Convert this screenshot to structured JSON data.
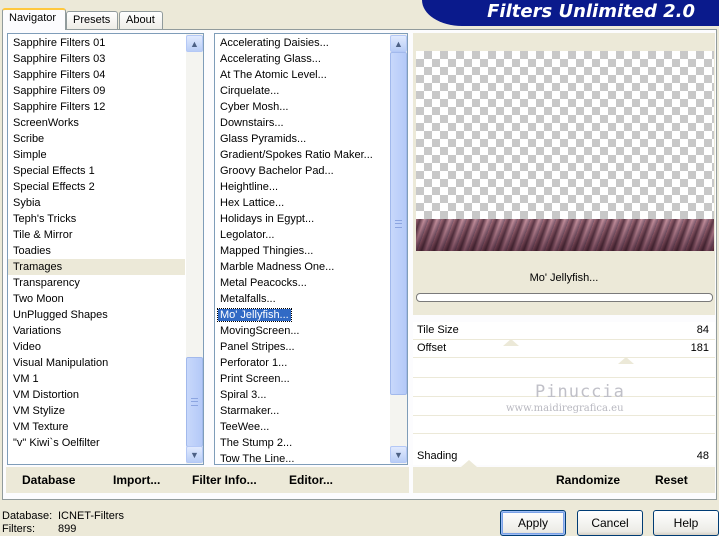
{
  "tabs": [
    "Navigator",
    "Presets",
    "About"
  ],
  "banner_title": "Filters Unlimited 2.0",
  "categories": [
    "Sapphire Filters 01",
    "Sapphire Filters 03",
    "Sapphire Filters 04",
    "Sapphire Filters 09",
    "Sapphire Filters 12",
    "ScreenWorks",
    "Scribe",
    "Simple",
    "Special Effects 1",
    "Special Effects 2",
    "Sybia",
    "Teph's Tricks",
    "Tile & Mirror",
    "Toadies",
    "Tramages",
    "Transparency",
    "Two Moon",
    "UnPlugged Shapes",
    "Variations",
    "Video",
    "Visual Manipulation",
    "VM 1",
    "VM Distortion",
    "VM Stylize",
    "VM Texture",
    "\"v\" Kiwi`s Oelfilter"
  ],
  "selected_category": "Tramages",
  "filters": [
    "Accelerating Daisies...",
    "Accelerating Glass...",
    "At The Atomic Level...",
    "Cirquelate...",
    "Cyber Mosh...",
    "Downstairs...",
    "Glass Pyramids...",
    "Gradient/Spokes Ratio Maker...",
    "Groovy Bachelor Pad...",
    "Heightline...",
    "Hex Lattice...",
    "Holidays in Egypt...",
    "Legolator...",
    "Mapped Thingies...",
    "Marble Madness One...",
    "Metal Peacocks...",
    "Metalfalls...",
    "Mo' Jellyfish...",
    "MovingScreen...",
    "Panel Stripes...",
    "Perforator 1...",
    "Print Screen...",
    "Spiral 3...",
    "Starmaker...",
    "TeeWee...",
    "The Stump 2...",
    "Tow The Line..."
  ],
  "selected_filter": "Mo' Jellyfish...",
  "current_filter_name": "Mo' Jellyfish...",
  "sliders": [
    {
      "label": "Tile Size",
      "value": "84"
    },
    {
      "label": "Offset",
      "value": "181"
    },
    {
      "label": "Shading",
      "value": "48"
    }
  ],
  "watermark": {
    "main": "Pinuccia",
    "sub": "www.maidiregrafica.eu"
  },
  "toolbar": {
    "database": "Database",
    "import": "Import...",
    "filter_info": "Filter Info...",
    "editor": "Editor...",
    "randomize": "Randomize",
    "reset": "Reset"
  },
  "status": {
    "database_label": "Database:",
    "database_value": "ICNET-Filters",
    "filters_label": "Filters:",
    "filters_value": "899"
  },
  "buttons": {
    "apply": "Apply",
    "cancel": "Cancel",
    "help": "Help"
  }
}
